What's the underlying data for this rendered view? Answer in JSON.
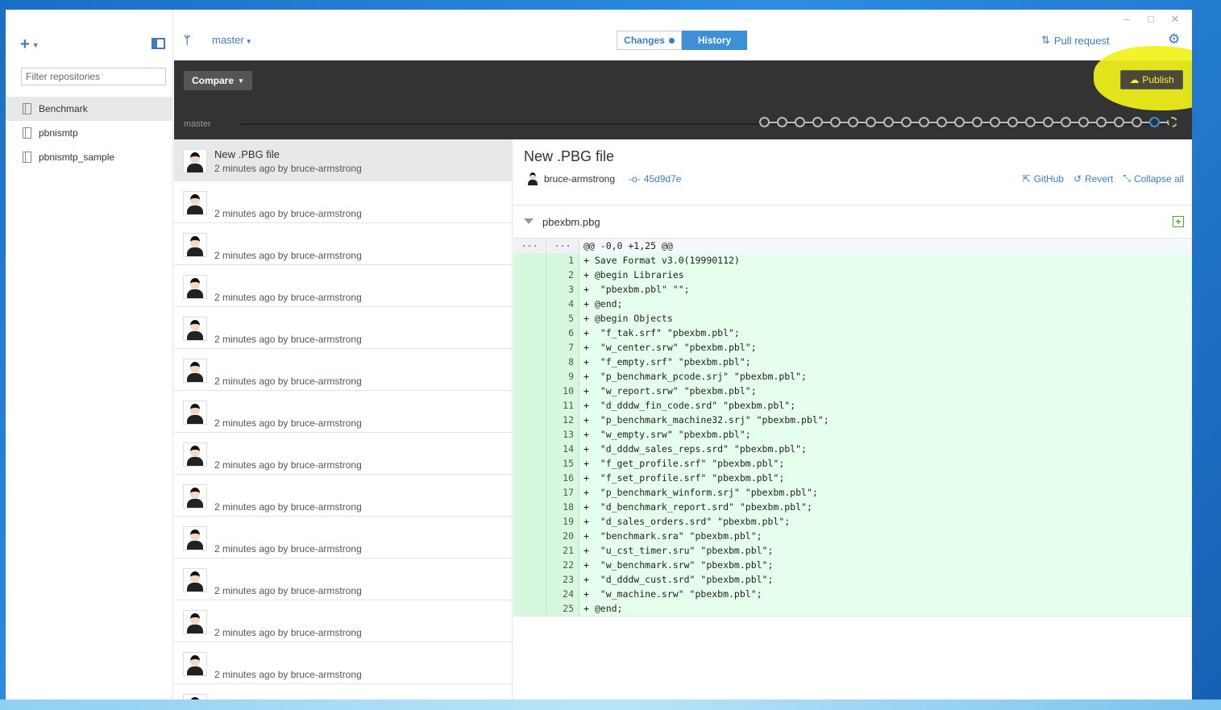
{
  "window": {
    "minimize": "–",
    "maximize": "□",
    "close": "✕"
  },
  "sidebar": {
    "add_label": "+",
    "filter_placeholder": "Filter repositories",
    "repos": [
      {
        "name": "Benchmark"
      },
      {
        "name": "pbnismtp"
      },
      {
        "name": "pbnismtp_sample"
      }
    ]
  },
  "topbar": {
    "branch": "master",
    "tab_changes": "Changes",
    "tab_history": "History",
    "pull_request": "Pull request"
  },
  "compare": {
    "button": "Compare",
    "publish": "Publish",
    "timeline_branch": "master",
    "node_count": 24
  },
  "commits": [
    {
      "title": "New .PBG file",
      "meta": "2 minutes ago by bruce-armstrong"
    },
    {
      "title": "",
      "meta": "2 minutes ago by bruce-armstrong"
    },
    {
      "title": "",
      "meta": "2 minutes ago by bruce-armstrong"
    },
    {
      "title": "",
      "meta": "2 minutes ago by bruce-armstrong"
    },
    {
      "title": "",
      "meta": "2 minutes ago by bruce-armstrong"
    },
    {
      "title": "",
      "meta": "2 minutes ago by bruce-armstrong"
    },
    {
      "title": "",
      "meta": "2 minutes ago by bruce-armstrong"
    },
    {
      "title": "",
      "meta": "2 minutes ago by bruce-armstrong"
    },
    {
      "title": "",
      "meta": "2 minutes ago by bruce-armstrong"
    },
    {
      "title": "",
      "meta": "2 minutes ago by bruce-armstrong"
    },
    {
      "title": "",
      "meta": "2 minutes ago by bruce-armstrong"
    },
    {
      "title": "",
      "meta": "2 minutes ago by bruce-armstrong"
    },
    {
      "title": "",
      "meta": "2 minutes ago by bruce-armstrong"
    },
    {
      "title": "",
      "meta": ""
    }
  ],
  "detail": {
    "title": "New .PBG file",
    "author": "bruce-armstrong",
    "sha": "45d9d7e",
    "github": "GitHub",
    "revert": "Revert",
    "collapse": "Collapse all",
    "file": "pbexbm.pbg",
    "hunk_gutter": "···",
    "hunk": "@@ -0,0 +1,25 @@",
    "lines": [
      "+ Save Format v3.0(19990112)",
      "+ @begin Libraries",
      "+  \"pbexbm.pbl\" \"\";",
      "+ @end;",
      "+ @begin Objects",
      "+  \"f_tak.srf\" \"pbexbm.pbl\";",
      "+  \"w_center.srw\" \"pbexbm.pbl\";",
      "+  \"f_empty.srf\" \"pbexbm.pbl\";",
      "+  \"p_benchmark_pcode.srj\" \"pbexbm.pbl\";",
      "+  \"w_report.srw\" \"pbexbm.pbl\";",
      "+  \"d_dddw_fin_code.srd\" \"pbexbm.pbl\";",
      "+  \"p_benchmark_machine32.srj\" \"pbexbm.pbl\";",
      "+  \"w_empty.srw\" \"pbexbm.pbl\";",
      "+  \"d_dddw_sales_reps.srd\" \"pbexbm.pbl\";",
      "+  \"f_get_profile.srf\" \"pbexbm.pbl\";",
      "+  \"f_set_profile.srf\" \"pbexbm.pbl\";",
      "+  \"p_benchmark_winform.srj\" \"pbexbm.pbl\";",
      "+  \"d_benchmark_report.srd\" \"pbexbm.pbl\";",
      "+  \"d_sales_orders.srd\" \"pbexbm.pbl\";",
      "+  \"benchmark.sra\" \"pbexbm.pbl\";",
      "+  \"u_cst_timer.sru\" \"pbexbm.pbl\";",
      "+  \"w_benchmark.srw\" \"pbexbm.pbl\";",
      "+  \"d_dddw_cust.srd\" \"pbexbm.pbl\";",
      "+  \"w_machine.srw\" \"pbexbm.pbl\";",
      "+ @end;"
    ]
  },
  "colors": {
    "accent": "#3d7cc3",
    "diff_add": "#e6ffed",
    "highlight": "#f2f21a"
  }
}
